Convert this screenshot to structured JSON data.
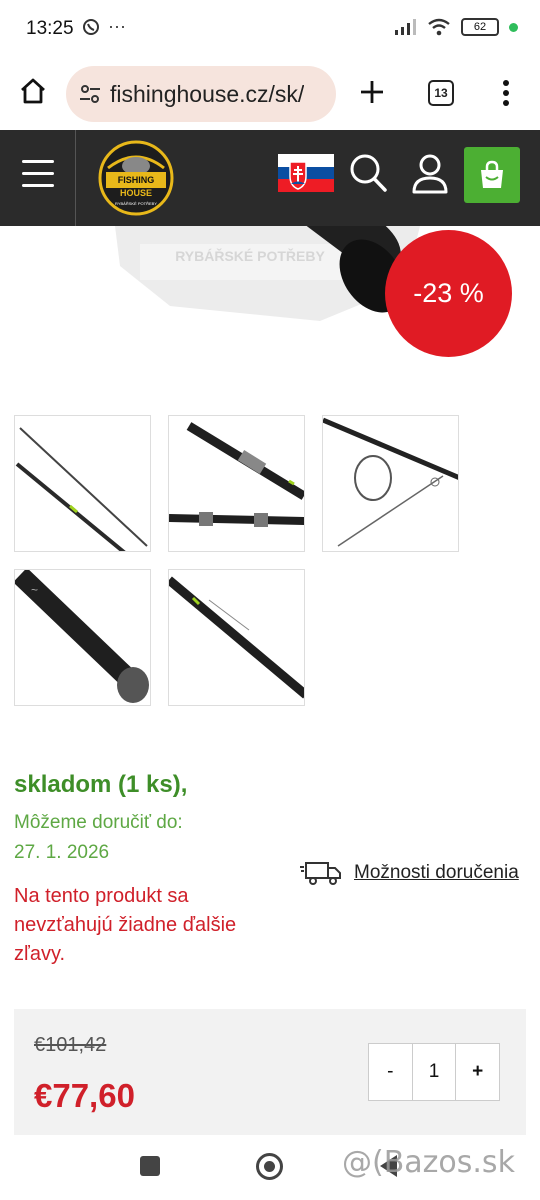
{
  "status": {
    "time": "13:25",
    "battery": "62"
  },
  "browser": {
    "url": "fishinghouse.cz/sk/",
    "tab_count": "13"
  },
  "header": {
    "logo_text_line1": "FISHING",
    "logo_text_line2": "HOUSE",
    "logo_subtitle": "RYBÁŘSKÉ POTŘEBY"
  },
  "hero": {
    "discount": "-23 %",
    "watermark_text": "RYBÁŘSKÉ POTŘEBY"
  },
  "product": {
    "stock": "skladom (1 ks),",
    "delivery_label": "Môžeme doručiť do:",
    "delivery_date": "27. 1. 2026",
    "delivery_options": "Možnosti doručenia",
    "no_discount_note": "Na tento produkt sa nevzťahujú žiadne ďalšie zľavy."
  },
  "price": {
    "old": "€101,42",
    "new": "€77,60"
  },
  "quantity": {
    "minus": "-",
    "value": "1",
    "plus": "+"
  },
  "watermark": "@(Bazos.sk",
  "colors": {
    "brand_green": "#4caf33",
    "discount_red": "#e01b24",
    "header_dark": "#2b2b2b",
    "stock_green": "#3e8e28"
  }
}
